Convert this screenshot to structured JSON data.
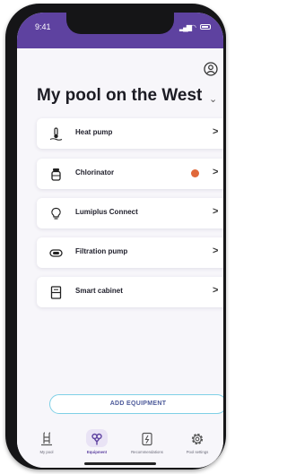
{
  "status": {
    "time": "9:41"
  },
  "page": {
    "title": "My pool on the West"
  },
  "equipment": [
    {
      "label": "Heat pump",
      "icon": "heat-pump-icon",
      "alert": false
    },
    {
      "label": "Chlorinator",
      "icon": "chlorinator-icon",
      "alert": true
    },
    {
      "label": "Lumiplus Connect",
      "icon": "bulb-icon",
      "alert": false
    },
    {
      "label": "Filtration pump",
      "icon": "pump-icon",
      "alert": false
    },
    {
      "label": "Smart cabinet",
      "icon": "cabinet-icon",
      "alert": false
    }
  ],
  "add_button": {
    "label": "ADD EQUIPMENT"
  },
  "nav": [
    {
      "label": "My pool",
      "icon": "pool-ladder-icon",
      "active": false
    },
    {
      "label": "Equipment",
      "icon": "equipment-icon",
      "active": true
    },
    {
      "label": "Recommendations",
      "icon": "recommendations-icon",
      "active": false
    },
    {
      "label": "Pool settings",
      "icon": "settings-gear-icon",
      "active": false
    }
  ],
  "colors": {
    "header": "#5e42a0",
    "alert": "#e0683a",
    "button_border": "#7fd0e6"
  }
}
